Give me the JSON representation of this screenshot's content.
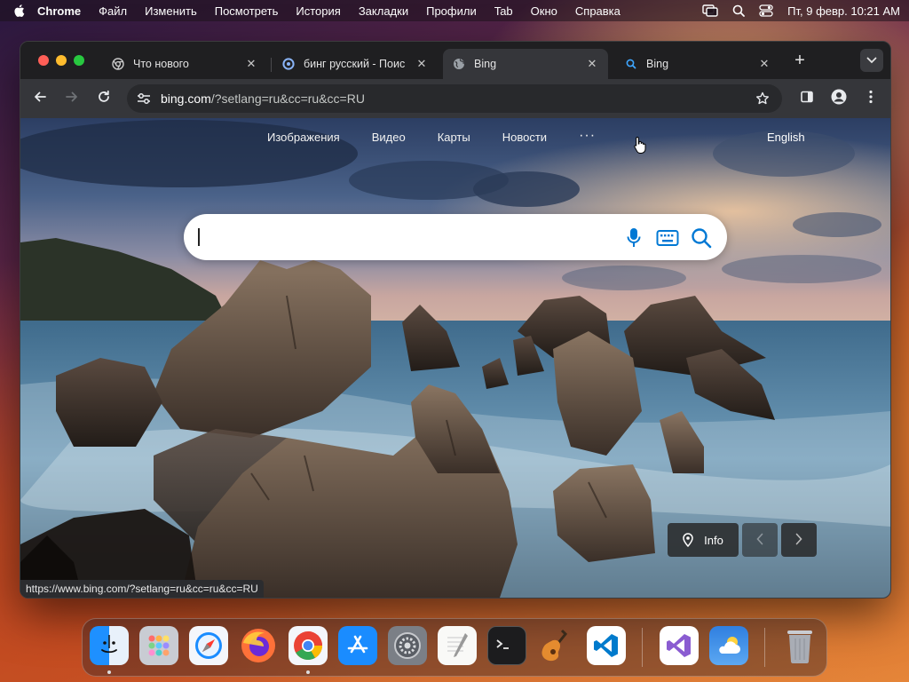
{
  "menubar": {
    "app_name": "Chrome",
    "items": [
      "Файл",
      "Изменить",
      "Посмотреть",
      "История",
      "Закладки",
      "Профили",
      "Tab",
      "Окно",
      "Справка"
    ],
    "clock": "Пт, 9 февр.  10:21 AM"
  },
  "tabs": [
    {
      "title": "Что нового",
      "icon": "chrome-icon"
    },
    {
      "title": "бинг русский - Поис",
      "icon": "search-engine-icon"
    },
    {
      "title": "Bing",
      "icon": "globe-icon",
      "active": true
    },
    {
      "title": "Bing",
      "icon": "bing-search-icon"
    }
  ],
  "toolbar": {
    "url_host": "bing.com",
    "url_rest": "/?setlang=ru&cc=ru&cc=RU"
  },
  "bing": {
    "nav": [
      "Изображения",
      "Видео",
      "Карты",
      "Новости"
    ],
    "more_label": "···",
    "language_link": "English",
    "search_value": "",
    "info_label": "Info",
    "status_url": "https://www.bing.com/?setlang=ru&cc=ru&cc=RU"
  },
  "dock": {
    "apps": [
      "Finder",
      "Launchpad",
      "Safari",
      "Firefox",
      "Chrome",
      "App Store",
      "System Settings",
      "TextEdit",
      "Terminal",
      "GarageBand",
      "Visual Studio Code",
      "Visual Studio",
      "Weather",
      "Trash"
    ]
  },
  "colors": {
    "accent_blue": "#0078d4",
    "traffic_red": "#ff5f57",
    "traffic_yellow": "#febc2e",
    "traffic_green": "#28c840"
  }
}
